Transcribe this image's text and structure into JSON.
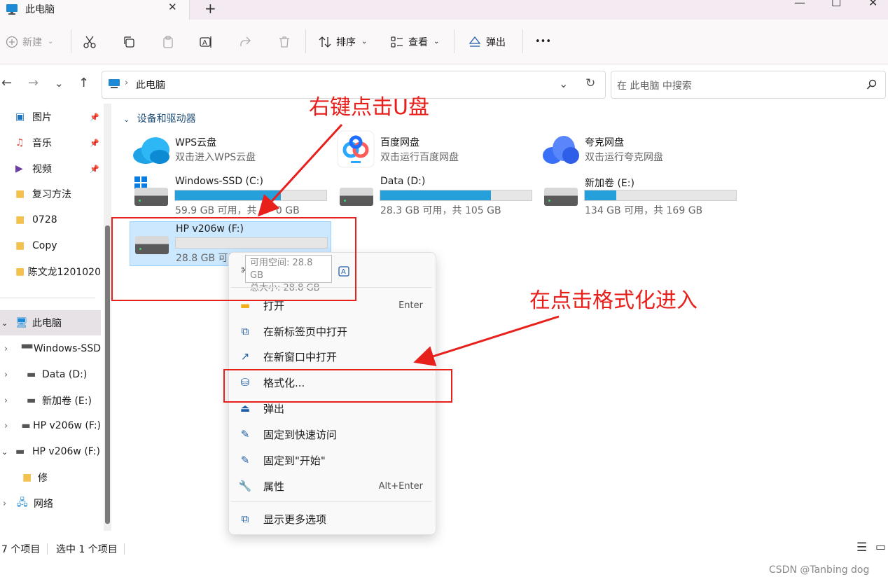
{
  "window": {
    "tab_title": "此电脑",
    "close_glyph": "✕",
    "new_tab_glyph": "+",
    "min_glyph": "—",
    "max_glyph": "☐",
    "winclose_glyph": "✕"
  },
  "toolbar": {
    "new_label": "新建",
    "sort_label": "排序",
    "view_label": "查看",
    "eject_label": "弹出",
    "more_glyph": "•••"
  },
  "address": {
    "location": "此电脑",
    "search_placeholder": "在 此电脑 中搜索"
  },
  "sidebar": {
    "quick": [
      {
        "label": "图片",
        "icon": "pictures-icon",
        "pinned": true
      },
      {
        "label": "音乐",
        "icon": "music-icon",
        "pinned": true
      },
      {
        "label": "视频",
        "icon": "video-icon",
        "pinned": true
      },
      {
        "label": "复习方法",
        "icon": "folder-icon"
      },
      {
        "label": "0728",
        "icon": "folder-icon"
      },
      {
        "label": "Copy",
        "icon": "folder-icon"
      },
      {
        "label": "陈文龙1201020",
        "icon": "folder-icon"
      }
    ],
    "this_pc": "此电脑",
    "drives": [
      "Windows-SSD",
      "Data (D:)",
      "新加卷 (E:)",
      "HP v206w (F:)"
    ],
    "usb_root": "HP v206w (F:)",
    "usb_child": "修",
    "network": "网络"
  },
  "content": {
    "section_title": "设备和驱动器",
    "cloud": [
      {
        "name": "WPS云盘",
        "desc": "双击进入WPS云盘",
        "icon": "wps-cloud-icon"
      },
      {
        "name": "百度网盘",
        "desc": "双击运行百度网盘",
        "icon": "baidu-netdisk-icon"
      },
      {
        "name": "夸克网盘",
        "desc": "双击运行夸克网盘",
        "icon": "quark-netdisk-icon"
      }
    ],
    "drives": [
      {
        "name": "Windows-SSD (C:)",
        "free": "59.9 GB 可用，共 4",
        "free_tail": "0 GB",
        "used": 0.7
      },
      {
        "name": "Data (D:)",
        "free": "28.3 GB 可用，共 105 GB",
        "used": 0.73
      },
      {
        "name": "新加卷 (E:)",
        "free": "134 GB 可用，共 169 GB",
        "used": 0.21
      }
    ],
    "usb": {
      "name": "HP v206w (F:)",
      "free": "28.8 GB 可用",
      "used": 0.0
    }
  },
  "tooltip": {
    "line1": "可用空间: 28.8 GB",
    "line2": "总大小: 28.8 GB"
  },
  "context_menu": {
    "items": [
      {
        "label": "打开",
        "accel": "Enter",
        "icon": "open-icon"
      },
      {
        "label": "在新标签页中打开",
        "accel": "",
        "icon": "new-tab-icon"
      },
      {
        "label": "在新窗口中打开",
        "accel": "",
        "icon": "new-window-icon"
      },
      {
        "label": "格式化...",
        "accel": "",
        "icon": "format-icon"
      },
      {
        "label": "弹出",
        "accel": "",
        "icon": "eject-icon"
      },
      {
        "label": "固定到快速访问",
        "accel": "",
        "icon": "pin-icon"
      },
      {
        "label": "固定到\"开始\"",
        "accel": "",
        "icon": "pin-icon"
      },
      {
        "label": "属性",
        "accel": "Alt+Enter",
        "icon": "wrench-icon"
      },
      {
        "label": "显示更多选项",
        "accel": "",
        "icon": "more-options-icon"
      }
    ]
  },
  "annotations": {
    "top_text": "右键点击U盘",
    "right_text": "在点击格式化进入"
  },
  "status": {
    "count": "7 个项目",
    "selected": "选中 1 个项目"
  },
  "watermark": "CSDN @Tanbing dog",
  "colors": {
    "accent": "#26a0da",
    "selection": "#cce8ff",
    "annotation_red": "#e8201c"
  }
}
